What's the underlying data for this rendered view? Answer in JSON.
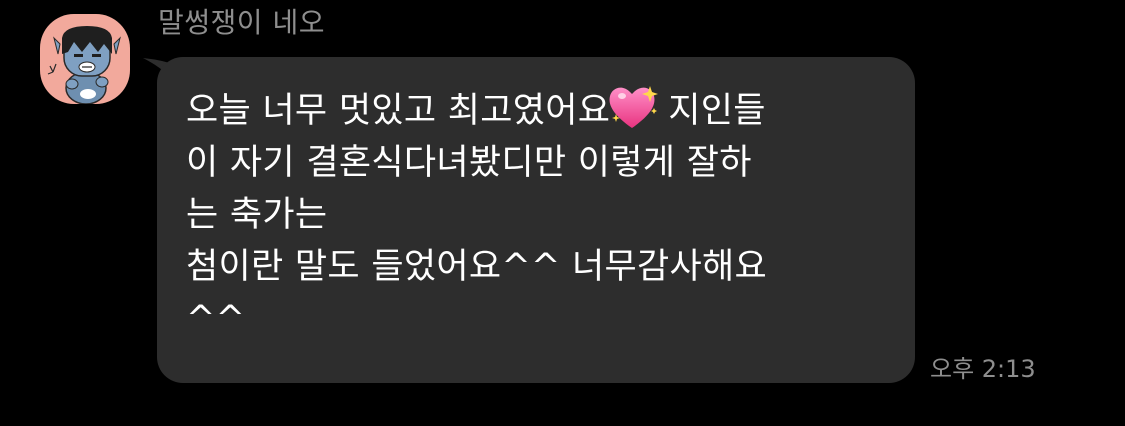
{
  "sender": {
    "name": "말썽쟁이 네오",
    "avatar_icon": "kakao-character-avatar",
    "avatar_bg": "#f2a99c"
  },
  "message": {
    "line1_before_emoji": "오늘 너무 멋있고 최고였어요",
    "emoji_icon": "sparkling-heart-icon",
    "line1_after_emoji": "지인들",
    "rest": "이 자기 결혼식다녀봤디만 이렇게 잘하\n는 축가는\n첨이란 말도 들었어요^^ 너무감사해요\n^^",
    "bubble_color": "#2d2d2d"
  },
  "timestamp": "오후 2:13"
}
